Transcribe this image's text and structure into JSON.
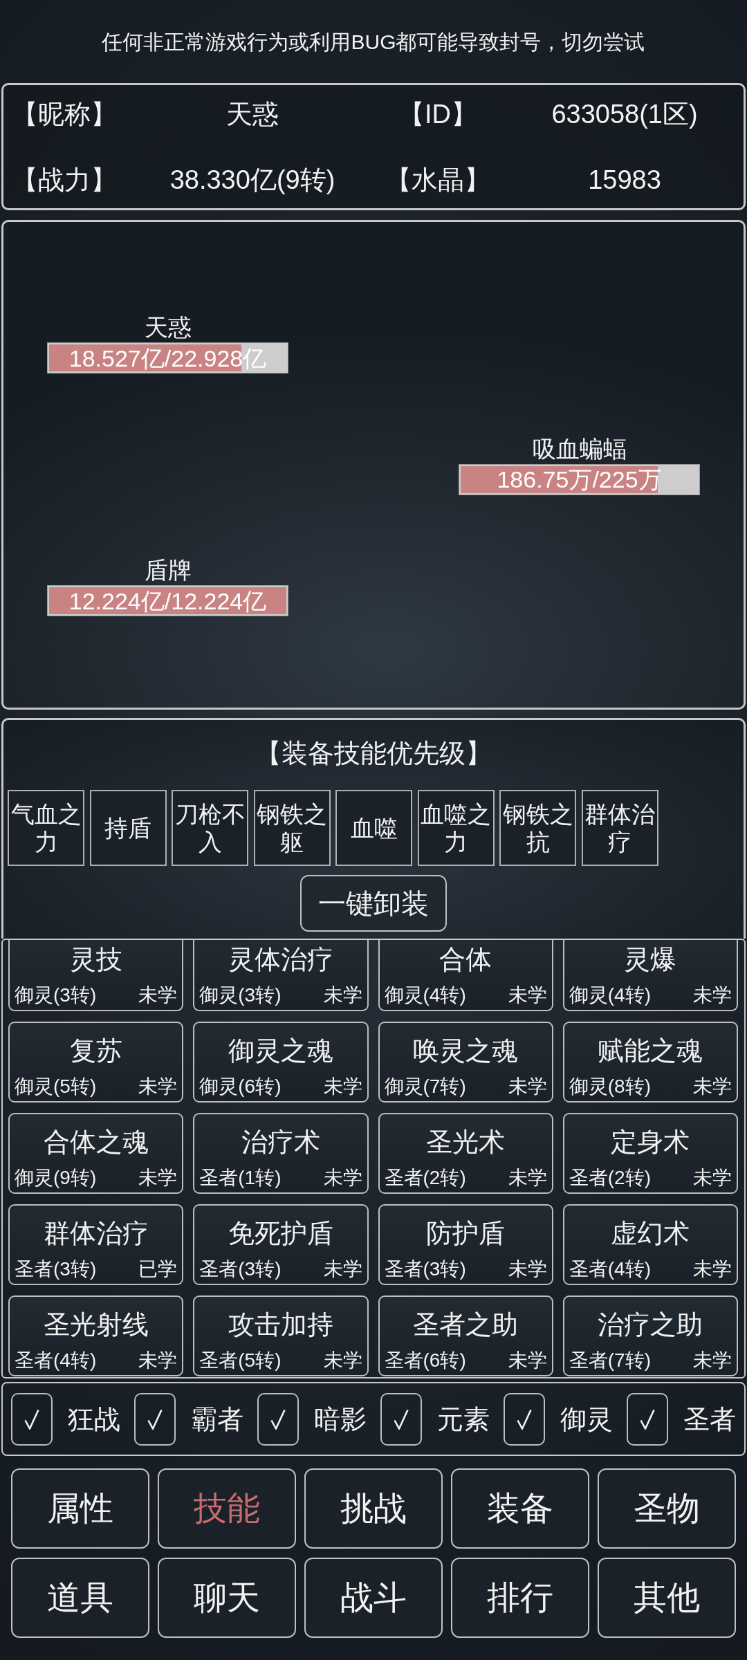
{
  "notice": "任何非正常游戏行为或利用BUG都可能导致封号，切勿尝试",
  "profile": [
    {
      "label": "【昵称】",
      "value": "天惑"
    },
    {
      "label": "【ID】",
      "value": "633058(1区)"
    },
    {
      "label": "【战力】",
      "value": "38.330亿(9转)"
    },
    {
      "label": "【水晶】",
      "value": "15983"
    }
  ],
  "battle": {
    "units": [
      {
        "name": "天惑",
        "kind": "ally",
        "hp": "18.527亿/22.928亿",
        "level": 0.81
      },
      {
        "name": "吸血蝙蝠",
        "kind": "enemy",
        "hp": "186.75万/225万",
        "level": 0.83
      },
      {
        "name": "盾牌",
        "kind": "ally",
        "hp": "12.224亿/12.224亿",
        "level": 1
      }
    ]
  },
  "equip_priority": {
    "title": "【装备技能优先级】",
    "slots": [
      "气血之力",
      "持盾",
      "刀枪不入",
      "钢铁之躯",
      "血噬",
      "血噬之力",
      "钢铁之抗",
      "群体治疗"
    ],
    "unequip_button": "一键卸装"
  },
  "skills": [
    {
      "name": "灵技",
      "requirement": "御灵(3转)",
      "status": "未学"
    },
    {
      "name": "灵体治疗",
      "requirement": "御灵(3转)",
      "status": "未学"
    },
    {
      "name": "合体",
      "requirement": "御灵(4转)",
      "status": "未学"
    },
    {
      "name": "灵爆",
      "requirement": "御灵(4转)",
      "status": "未学"
    },
    {
      "name": "复苏",
      "requirement": "御灵(5转)",
      "status": "未学"
    },
    {
      "name": "御灵之魂",
      "requirement": "御灵(6转)",
      "status": "未学"
    },
    {
      "name": "唤灵之魂",
      "requirement": "御灵(7转)",
      "status": "未学"
    },
    {
      "name": "赋能之魂",
      "requirement": "御灵(8转)",
      "status": "未学"
    },
    {
      "name": "合体之魂",
      "requirement": "御灵(9转)",
      "status": "未学"
    },
    {
      "name": "治疗术",
      "requirement": "圣者(1转)",
      "status": "未学"
    },
    {
      "name": "圣光术",
      "requirement": "圣者(2转)",
      "status": "未学"
    },
    {
      "name": "定身术",
      "requirement": "圣者(2转)",
      "status": "未学"
    },
    {
      "name": "群体治疗",
      "requirement": "圣者(3转)",
      "status": "已学"
    },
    {
      "name": "免死护盾",
      "requirement": "圣者(3转)",
      "status": "未学"
    },
    {
      "name": "防护盾",
      "requirement": "圣者(3转)",
      "status": "未学"
    },
    {
      "name": "虚幻术",
      "requirement": "圣者(4转)",
      "status": "未学"
    },
    {
      "name": "圣光射线",
      "requirement": "圣者(4转)",
      "status": "未学"
    },
    {
      "name": "攻击加持",
      "requirement": "圣者(5转)",
      "status": "未学"
    },
    {
      "name": "圣者之助",
      "requirement": "圣者(6转)",
      "status": "未学"
    },
    {
      "name": "治疗之助",
      "requirement": "圣者(7转)",
      "status": "未学"
    }
  ],
  "filters": [
    {
      "label": "狂战",
      "checked": true
    },
    {
      "label": "霸者",
      "checked": true
    },
    {
      "label": "暗影",
      "checked": true
    },
    {
      "label": "元素",
      "checked": true
    },
    {
      "label": "御灵",
      "checked": true
    },
    {
      "label": "圣者",
      "checked": true
    }
  ],
  "nav": [
    {
      "label": "属性",
      "selected": false
    },
    {
      "label": "技能",
      "selected": true
    },
    {
      "label": "挑战",
      "selected": false
    },
    {
      "label": "装备",
      "selected": false
    },
    {
      "label": "圣物",
      "selected": false
    },
    {
      "label": "道具",
      "selected": false
    },
    {
      "label": "聊天",
      "selected": false
    },
    {
      "label": "战斗",
      "selected": false
    },
    {
      "label": "排行",
      "selected": false
    },
    {
      "label": "其他",
      "selected": false
    }
  ]
}
